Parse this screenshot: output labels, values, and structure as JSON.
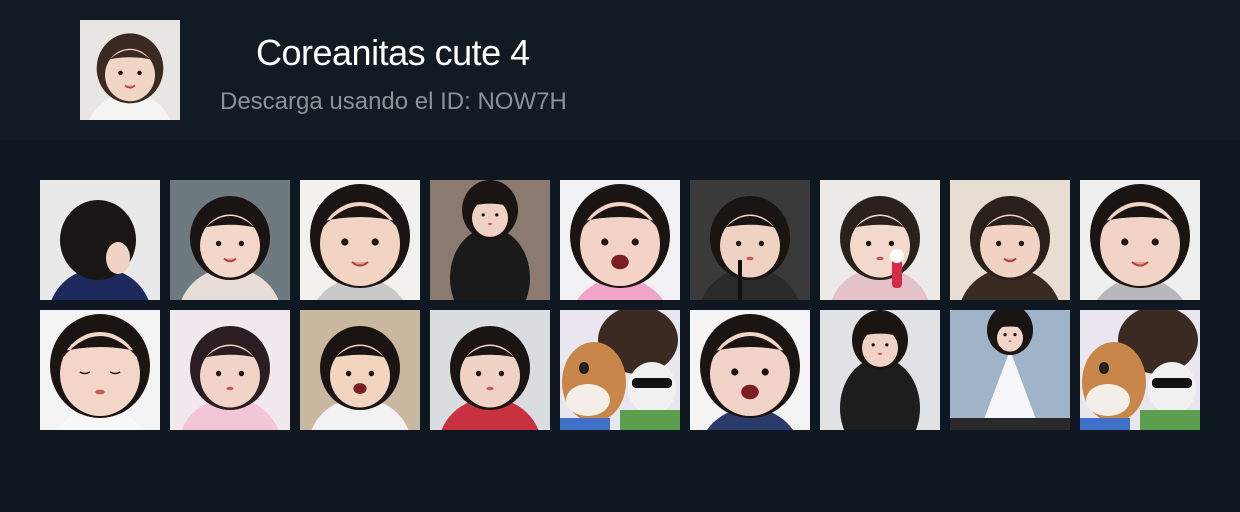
{
  "pack": {
    "title": "Coreanitas cute 4",
    "subtitle": "Descarga usando el ID: NOW7H",
    "thumbnail": {
      "bg": "#e8e6e2",
      "hair": "#3a2a22",
      "skin": "#f1d6c6",
      "clothes": "#f4f4f2",
      "hat": "#c9b9a8"
    }
  },
  "stickers": [
    {
      "bg": "#e9e9ea",
      "hair": "#1b1616",
      "skin": "#efd3c5",
      "clothes": "#1c2a5e",
      "pose": "back"
    },
    {
      "bg": "#6f7a80",
      "hair": "#1a1513",
      "skin": "#f3d7c8",
      "clothes": "#e8ddd6",
      "pose": "smile"
    },
    {
      "bg": "#f3f1ee",
      "hair": "#1a1513",
      "skin": "#f3d3c2",
      "clothes": "#c8c8c8",
      "pose": "closeup"
    },
    {
      "bg": "#8a7a70",
      "hair": "#1a1513",
      "skin": "#efd2c4",
      "clothes": "#1a1a1a",
      "pose": "standing"
    },
    {
      "bg": "#f2f2f4",
      "hair": "#1a1513",
      "skin": "#f4d2c6",
      "clothes": "#f0a4c8",
      "pose": "wide"
    },
    {
      "bg": "#3a3a3a",
      "hair": "#1a1513",
      "skin": "#f0d2c2",
      "clothes": "#2a2a2a",
      "pose": "eating"
    },
    {
      "bg": "#ede9e6",
      "hair": "#2a201c",
      "skin": "#f3d8cc",
      "clothes": "#e5c1c8",
      "pose": "lean"
    },
    {
      "bg": "#e7ddd2",
      "hair": "#2a201c",
      "skin": "#f2d3c3",
      "clothes": "#3a2a24",
      "pose": "wave"
    },
    {
      "bg": "#efefef",
      "hair": "#1a1513",
      "skin": "#f2d4c6",
      "clothes": "#b9b9bd",
      "pose": "closeup"
    },
    {
      "bg": "#f3f3f3",
      "hair": "#1a1513",
      "skin": "#f3d6c8",
      "clothes": "#f7f7f7",
      "pose": "down"
    },
    {
      "bg": "#f1e9ee",
      "hair": "#2a1e22",
      "skin": "#f1d3c8",
      "clothes": "#f2c6d6",
      "pose": "coat"
    },
    {
      "bg": "#c9b79f",
      "hair": "#1a1513",
      "skin": "#f3d4bf",
      "clothes": "#f2f2f2",
      "pose": "laugh"
    },
    {
      "bg": "#dadde0",
      "hair": "#1a1513",
      "skin": "#f1d3c6",
      "clothes": "#c8313f",
      "pose": "shy"
    },
    {
      "bg": "#e9e6ef",
      "hair": "#3b2a22",
      "skin": "#c9864a",
      "clothes": "#5ca04f",
      "pose": "toys"
    },
    {
      "bg": "#f4f4f4",
      "hair": "#1a1513",
      "skin": "#f1d4c7",
      "clothes": "#2a3a6a",
      "pose": "cry"
    },
    {
      "bg": "#e0e2e4",
      "hair": "#1a1513",
      "skin": "#f1d3c5",
      "clothes": "#1e1e1e",
      "pose": "jacket"
    },
    {
      "bg": "#9fb4c8",
      "hair": "#1a1513",
      "skin": "#f1d6c8",
      "clothes": "#f7f7fb",
      "pose": "dress"
    },
    {
      "bg": "#e9e6ef",
      "hair": "#3b2a22",
      "skin": "#c9864a",
      "clothes": "#5ca04f",
      "pose": "toys"
    }
  ]
}
